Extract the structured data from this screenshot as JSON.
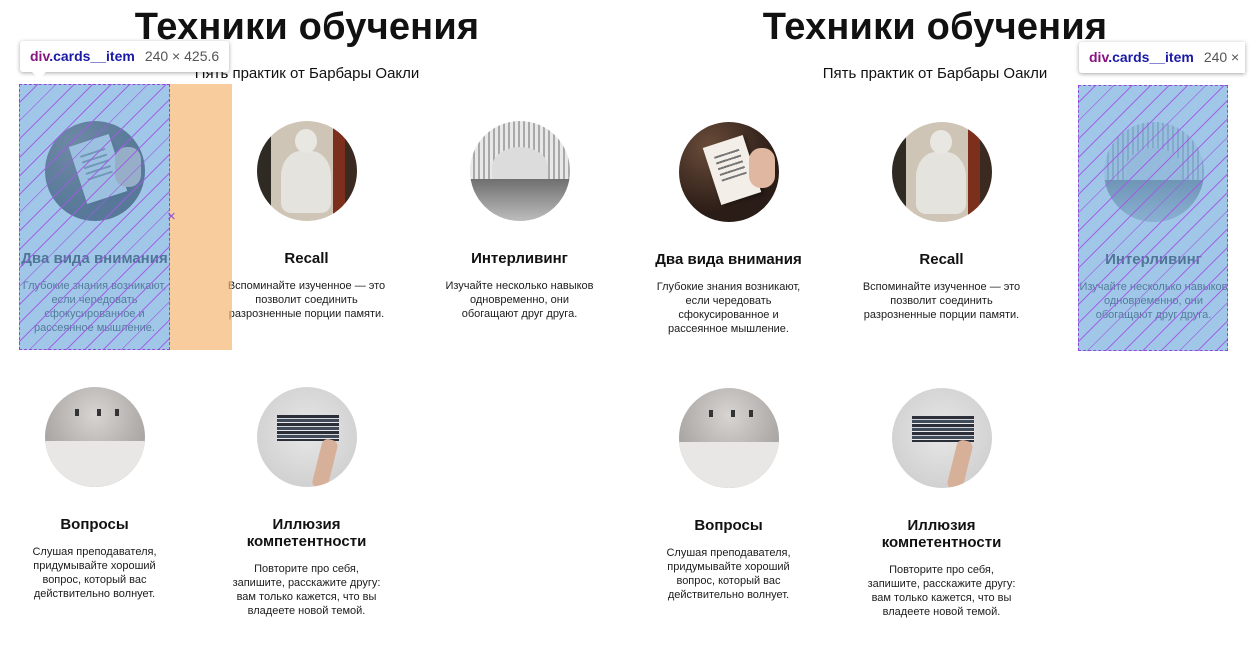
{
  "page": {
    "title": "Техники обучения",
    "subtitle": "Пять практик от Барбары Оакли"
  },
  "cards": [
    {
      "title": "Два вида внимания",
      "text": "Глубокие знания возникают, если чередовать сфокусированное и рассеянное мышление.",
      "image": "book-in-hands"
    },
    {
      "title": "Recall",
      "text": "Вспоминайте изученное — это позволит соединить разрозненные порции памяти.",
      "image": "marble-statue"
    },
    {
      "title": "Интерливинг",
      "text": "Изучайте несколько навыков одновременно, они обогащают друг друга.",
      "image": "white-arched-hall"
    },
    {
      "title": "Вопросы",
      "text": "Слушая преподавателя, придумывайте хороший вопрос, который вас действительно волнует.",
      "image": "empty-room"
    },
    {
      "title": "Иллюзия компетентности",
      "text": "Повторите про себя, запишите, расскажите другу: вам только кажется, что вы владеете новой темой.",
      "image": "stack-of-books"
    }
  ],
  "devtools": {
    "left_tooltip": {
      "tag": "div",
      "class": ".cards__item",
      "size": "240 × 425.6"
    },
    "right_tooltip": {
      "tag": "div",
      "class": ".cards__item",
      "size": "240 ×"
    },
    "highlight_color": "#6fa8dc",
    "margin_color": "#f6b26b",
    "hatch_color": "#a05ae6"
  }
}
